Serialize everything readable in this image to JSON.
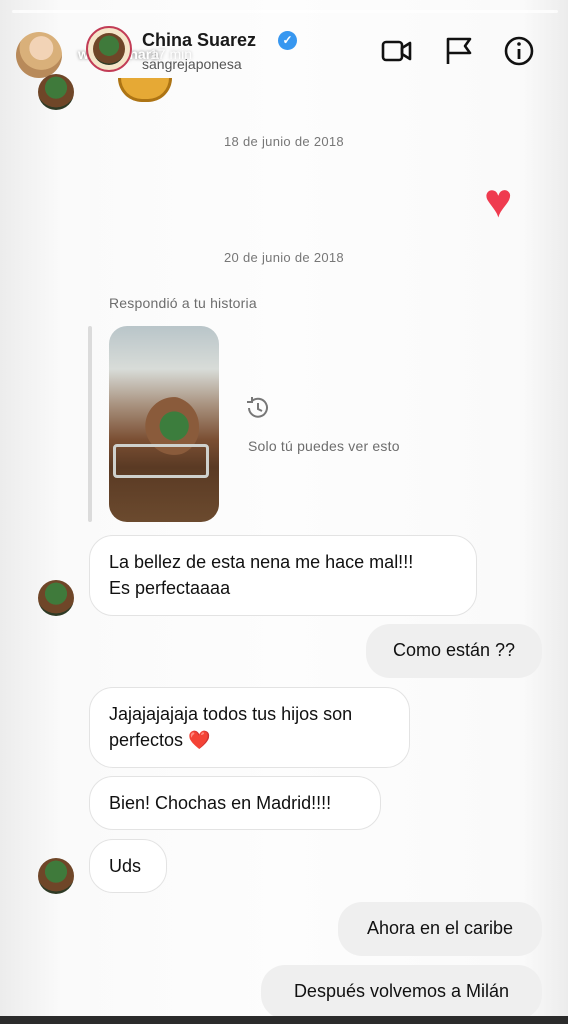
{
  "story": {
    "username": "wanda_nara",
    "time": "17 min"
  },
  "chat": {
    "name": "China Suarez",
    "handle": "sangrejaponesa",
    "verified_icon": "verified-badge-icon",
    "header_icons": [
      "video-call-icon",
      "flag-icon",
      "info-icon"
    ]
  },
  "dates": {
    "first": "18 de junio de 2018",
    "second": "20 de junio de 2018"
  },
  "story_reply": {
    "label": "Respondió a tu historia",
    "note": "Solo tú puedes ver esto"
  },
  "messages": {
    "m1_line1": "La bellez de esta nena me hace mal!!!",
    "m1_line2": "Es perfectaaaa",
    "m2": "Como están ??",
    "m3_line1": "Jajajajajaja todos tus hijos son",
    "m3_line2": "perfectos",
    "m3_emoji": "❤️",
    "m4": "Bien! Chochas en Madrid!!!!",
    "m5": "Uds",
    "m6": "Ahora en el caribe",
    "m7": "Después volvemos a Milán"
  },
  "colors": {
    "heart": "#ef3b4f",
    "verified": "#3797f0",
    "incoming_bubble": "#ffffff",
    "outgoing_bubble": "#efefef"
  }
}
